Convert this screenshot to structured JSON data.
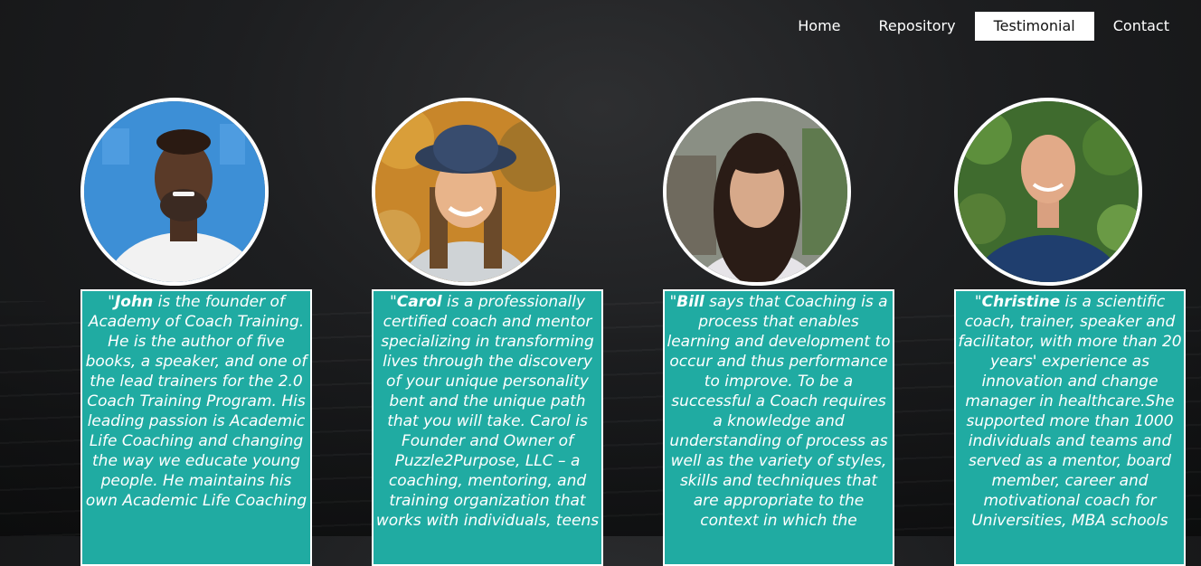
{
  "nav": {
    "items": [
      "Home",
      "Repository",
      "Testimonial",
      "Contact"
    ],
    "active": "Testimonial"
  },
  "testimonials": [
    {
      "name": "John",
      "open_quote": "\"",
      "text": " is the founder of Academy of Coach Training. He is the author of five books, a speaker, and one of the lead trainers for the 2.0 Coach Training Program. His leading passion is Academic Life Coaching and changing the way we educate young people. He maintains his own Academic Life Coaching"
    },
    {
      "name": "Carol",
      "open_quote": "\"",
      "text": " is a professionally certified coach and mentor specializing in transforming lives through the discovery of your unique personality bent and the unique path that you will take. Carol is Founder and Owner of Puzzle2Purpose, LLC – a coaching, mentoring, and training organization that works with individuals, teens"
    },
    {
      "name": "Bill",
      "open_quote": "\"",
      "text": " says that Coaching is a process that enables learning and development to occur and thus performance to improve. To be a successful a Coach requires a knowledge and understanding of process as well as the variety of styles, skills and techniques that are appropriate to the context in which the"
    },
    {
      "name": "Christine",
      "open_quote": "\"",
      "text": " is a scientific coach, trainer, speaker and facilitator, with more than 20 years' experience as innovation and change manager in healthcare.She supported more than 1000 individuals and teams and served as a mentor, board member, career and motivational coach for Universities, MBA schools"
    }
  ],
  "colors": {
    "teal": "#20aba2",
    "background": "#1d1e20",
    "white": "#ffffff"
  }
}
